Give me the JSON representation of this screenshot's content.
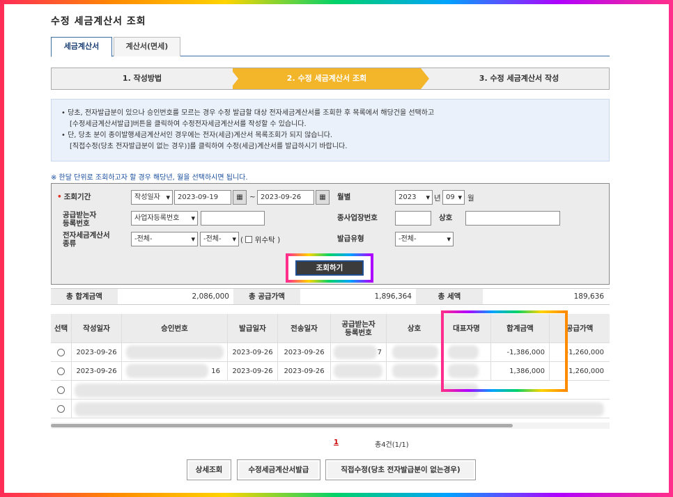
{
  "page_title": "수정 세금계산서 조회",
  "tabs": [
    "세금계산서",
    "계산서(면세)"
  ],
  "steps": [
    "1. 작성방법",
    "2. 수정 세금계산서 조회",
    "3. 수정 세금계산서 작성"
  ],
  "notice": [
    "• 당초, 전자발급분이 있으나 승인번호를 모르는 경우 수정 발급할 대상 전자세금계산서를 조회한 후 목록에서 해당건을 선택하고",
    "[수정세금계산서발급]버튼을 클릭하여 수정전자세금계산서를 작성할 수 있습니다.",
    "• 단, 당초 분이 종이발행세금계산서인 경우에는 전자(세금)계산서 목록조회가 되지 않습니다.",
    "[직접수정(당초 전자발급분이 없는 경우)]를 클릭하여 수정(세금)계산서를 발급하시기 바랍니다."
  ],
  "hint": "※ 한달 단위로 조회하고자 할 경우 해당년, 월을 선택하시면 됩니다.",
  "search": {
    "period_label": "조회기간",
    "date_type": "작성일자",
    "date_from": "2023-09-19",
    "date_to": "2023-09-26",
    "tilde": "~",
    "monthly_label": "월별",
    "year": "2023",
    "year_unit": "년",
    "month": "09",
    "month_unit": "월",
    "buyer_reg_label": "공급받는자\n등록번호",
    "reg_type": "사업자등록번호",
    "branch_label": "종사업장번호",
    "company_label": "상호",
    "invoice_type_label": "전자세금계산서\n종류",
    "invoice_type1": "-전체-",
    "invoice_type2": "-전체-",
    "consign_label": "위수탁",
    "issue_type_label": "발급유형",
    "issue_type": "-전체-",
    "search_button": "조회하기"
  },
  "totals": {
    "sum_label": "총 합계금액",
    "sum_value": "2,086,000",
    "supply_label": "총 공급가액",
    "supply_value": "1,896,364",
    "tax_label": "총 세액",
    "tax_value": "189,636"
  },
  "table": {
    "headers": [
      "선택",
      "작성일자",
      "승인번호",
      "발급일자",
      "전송일자",
      "공급받는자\n등록번호",
      "상호",
      "대표자명",
      "합계금액",
      "공급가액"
    ],
    "rows": [
      {
        "write_date": "2023-09-26",
        "approval_tail": "",
        "issue_date": "2023-09-26",
        "send_date": "2023-09-26",
        "reg_tail": "7",
        "total": "-1,386,000",
        "supply": "-1,260,000"
      },
      {
        "write_date": "2023-09-26",
        "approval_tail": "16",
        "issue_date": "2023-09-26",
        "send_date": "2023-09-26",
        "reg_tail": "",
        "total": "1,386,000",
        "supply": "1,260,000"
      }
    ]
  },
  "pager": {
    "current": "1",
    "count": "총4건(1/1)"
  },
  "buttons": [
    "상세조회",
    "수정세금계산서발급",
    "직접수정(당초 전자발급분이 없는경우)"
  ]
}
